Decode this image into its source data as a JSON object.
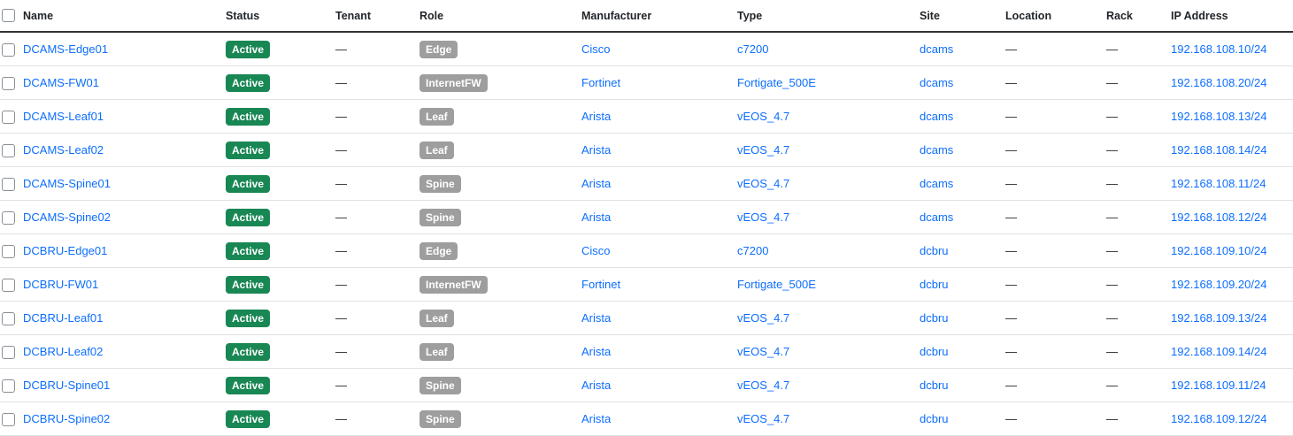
{
  "columns": [
    "Name",
    "Status",
    "Tenant",
    "Role",
    "Manufacturer",
    "Type",
    "Site",
    "Location",
    "Rack",
    "IP Address"
  ],
  "colors": {
    "status_active": "#198754",
    "role_badge": "#9e9e9e",
    "link": "#0d6efd"
  },
  "rows": [
    {
      "name": "DCAMS-Edge01",
      "status": "Active",
      "tenant": "—",
      "role": "Edge",
      "manufacturer": "Cisco",
      "type": "c7200",
      "site": "dcams",
      "location": "—",
      "rack": "—",
      "ip": "192.168.108.10/24"
    },
    {
      "name": "DCAMS-FW01",
      "status": "Active",
      "tenant": "—",
      "role": "InternetFW",
      "manufacturer": "Fortinet",
      "type": "Fortigate_500E",
      "site": "dcams",
      "location": "—",
      "rack": "—",
      "ip": "192.168.108.20/24"
    },
    {
      "name": "DCAMS-Leaf01",
      "status": "Active",
      "tenant": "—",
      "role": "Leaf",
      "manufacturer": "Arista",
      "type": "vEOS_4.7",
      "site": "dcams",
      "location": "—",
      "rack": "—",
      "ip": "192.168.108.13/24"
    },
    {
      "name": "DCAMS-Leaf02",
      "status": "Active",
      "tenant": "—",
      "role": "Leaf",
      "manufacturer": "Arista",
      "type": "vEOS_4.7",
      "site": "dcams",
      "location": "—",
      "rack": "—",
      "ip": "192.168.108.14/24"
    },
    {
      "name": "DCAMS-Spine01",
      "status": "Active",
      "tenant": "—",
      "role": "Spine",
      "manufacturer": "Arista",
      "type": "vEOS_4.7",
      "site": "dcams",
      "location": "—",
      "rack": "—",
      "ip": "192.168.108.11/24"
    },
    {
      "name": "DCAMS-Spine02",
      "status": "Active",
      "tenant": "—",
      "role": "Spine",
      "manufacturer": "Arista",
      "type": "vEOS_4.7",
      "site": "dcams",
      "location": "—",
      "rack": "—",
      "ip": "192.168.108.12/24"
    },
    {
      "name": "DCBRU-Edge01",
      "status": "Active",
      "tenant": "—",
      "role": "Edge",
      "manufacturer": "Cisco",
      "type": "c7200",
      "site": "dcbru",
      "location": "—",
      "rack": "—",
      "ip": "192.168.109.10/24"
    },
    {
      "name": "DCBRU-FW01",
      "status": "Active",
      "tenant": "—",
      "role": "InternetFW",
      "manufacturer": "Fortinet",
      "type": "Fortigate_500E",
      "site": "dcbru",
      "location": "—",
      "rack": "—",
      "ip": "192.168.109.20/24"
    },
    {
      "name": "DCBRU-Leaf01",
      "status": "Active",
      "tenant": "—",
      "role": "Leaf",
      "manufacturer": "Arista",
      "type": "vEOS_4.7",
      "site": "dcbru",
      "location": "—",
      "rack": "—",
      "ip": "192.168.109.13/24"
    },
    {
      "name": "DCBRU-Leaf02",
      "status": "Active",
      "tenant": "—",
      "role": "Leaf",
      "manufacturer": "Arista",
      "type": "vEOS_4.7",
      "site": "dcbru",
      "location": "—",
      "rack": "—",
      "ip": "192.168.109.14/24"
    },
    {
      "name": "DCBRU-Spine01",
      "status": "Active",
      "tenant": "—",
      "role": "Spine",
      "manufacturer": "Arista",
      "type": "vEOS_4.7",
      "site": "dcbru",
      "location": "—",
      "rack": "—",
      "ip": "192.168.109.11/24"
    },
    {
      "name": "DCBRU-Spine02",
      "status": "Active",
      "tenant": "—",
      "role": "Spine",
      "manufacturer": "Arista",
      "type": "vEOS_4.7",
      "site": "dcbru",
      "location": "—",
      "rack": "—",
      "ip": "192.168.109.12/24"
    }
  ]
}
